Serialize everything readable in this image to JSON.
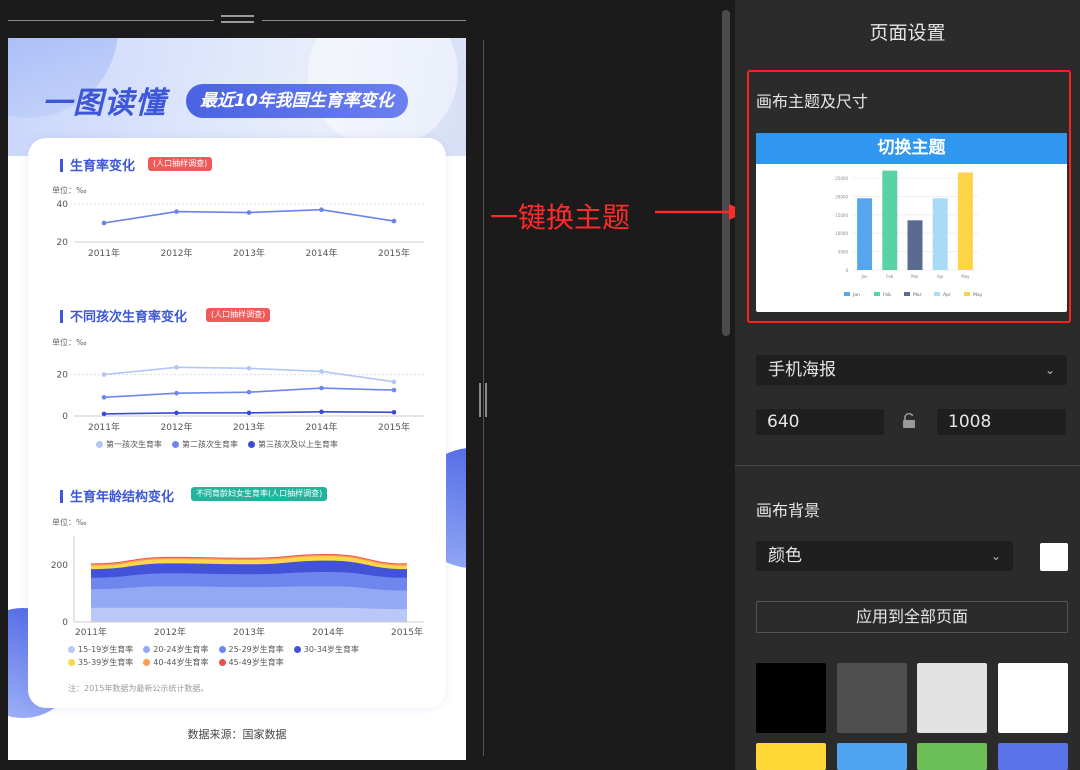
{
  "poster": {
    "title": "一图读懂",
    "subtitle": "最近10年我国生育率变化",
    "sections": [
      {
        "title": "生育率变化",
        "badge": "(人口抽样调查)",
        "badge_color": "#ef5a5a",
        "unit": "单位：‰"
      },
      {
        "title": "不同孩次生育率变化",
        "badge": "(人口抽样调查)",
        "badge_color": "#ef5a5a",
        "unit": "单位：‰"
      },
      {
        "title": "生育年龄结构变化",
        "badge": "不同育龄妇女生育率(人口抽样调查)",
        "badge_color": "#21b49c",
        "unit": "单位：‰"
      }
    ],
    "note": "注：2015年数据为最新公示统计数据。",
    "source": "数据来源：国家数据"
  },
  "annotation": {
    "text": "一键换主题",
    "color": "#ff2a2a"
  },
  "panel": {
    "title": "页面设置",
    "theme_section_title": "画布主题及尺寸",
    "theme_button": "切换主题",
    "size_preset": "手机海报",
    "width_value": "640",
    "height_value": "1008",
    "background_section_title": "画布背景",
    "background_type": "颜色",
    "background_color": "#ffffff",
    "apply_all": "应用到全部页面",
    "swatches": [
      "#000000",
      "#4f4f4f",
      "#e2e2e2",
      "#ffffff",
      "#fdd835",
      "#4fa3f0",
      "#6bc059",
      "#5b73e8"
    ]
  },
  "chart_data": [
    {
      "type": "line",
      "title": "生育率变化",
      "x": [
        "2011年",
        "2012年",
        "2013年",
        "2014年",
        "2015年"
      ],
      "series": [
        {
          "values": [
            30,
            36,
            35.5,
            37,
            31
          ],
          "color": "#6a80ee"
        }
      ],
      "ylim": [
        20,
        40
      ],
      "yticks": [
        20,
        40
      ],
      "ylabel": "单位：‰",
      "grid": true
    },
    {
      "type": "line",
      "title": "不同孩次生育率变化",
      "x": [
        "2011年",
        "2012年",
        "2013年",
        "2014年",
        "2015年"
      ],
      "series": [
        {
          "name": "第一孩次生育率",
          "values": [
            20,
            23.5,
            23,
            21.5,
            16.5
          ],
          "color": "#b4c6f8"
        },
        {
          "name": "第二孩次生育率",
          "values": [
            9,
            11,
            11.5,
            13.5,
            12.5
          ],
          "color": "#6f86ee"
        },
        {
          "name": "第三孩次及以上生育率",
          "values": [
            1,
            1.5,
            1.5,
            2,
            1.8
          ],
          "color": "#3b4bd6"
        }
      ],
      "ylim": [
        0,
        28
      ],
      "yticks": [
        0,
        20
      ],
      "ylabel": "单位：‰",
      "legend": "bottom"
    },
    {
      "type": "area",
      "title": "生育年龄结构变化",
      "x": [
        "2011年",
        "2012年",
        "2013年",
        "2014年",
        "2015年"
      ],
      "stacked": true,
      "series": [
        {
          "name": "15-19岁生育率",
          "values": [
            50,
            50,
            50,
            50,
            45
          ],
          "color": "#b9c8f8"
        },
        {
          "name": "20-24岁生育率",
          "values": [
            65,
            75,
            72,
            75,
            65
          ],
          "color": "#94a9f4"
        },
        {
          "name": "25-29岁生育率",
          "values": [
            40,
            45,
            45,
            50,
            45
          ],
          "color": "#6f86ee"
        },
        {
          "name": "30-34岁生育率",
          "values": [
            30,
            35,
            35,
            40,
            30
          ],
          "color": "#4353d8"
        },
        {
          "name": "35-39岁生育率",
          "values": [
            12,
            15,
            15,
            15,
            12
          ],
          "color": "#ffd54a"
        },
        {
          "name": "40-44岁生育率",
          "values": [
            5,
            5,
            5,
            5,
            5
          ],
          "color": "#ff9a4d"
        },
        {
          "name": "45-49岁生育率",
          "values": [
            3,
            3,
            3,
            3,
            3
          ],
          "color": "#e8504f"
        }
      ],
      "ylim": [
        0,
        280
      ],
      "yticks": [
        0,
        200
      ],
      "ylabel": "单位：‰",
      "legend": "bottom"
    },
    {
      "type": "bar",
      "title": "",
      "categories": [
        "Jan",
        "Feb",
        "Mar",
        "Apr",
        "May"
      ],
      "values": [
        19500,
        27000,
        13500,
        19500,
        26500
      ],
      "colors": [
        "#56a5ef",
        "#5ad2a4",
        "#5b6a90",
        "#a9dbf7",
        "#fdd34a"
      ],
      "ylim": [
        0,
        25000
      ],
      "yticks": [
        0,
        5000,
        10000,
        15000,
        20000,
        25000
      ],
      "legend": "bottom"
    }
  ]
}
